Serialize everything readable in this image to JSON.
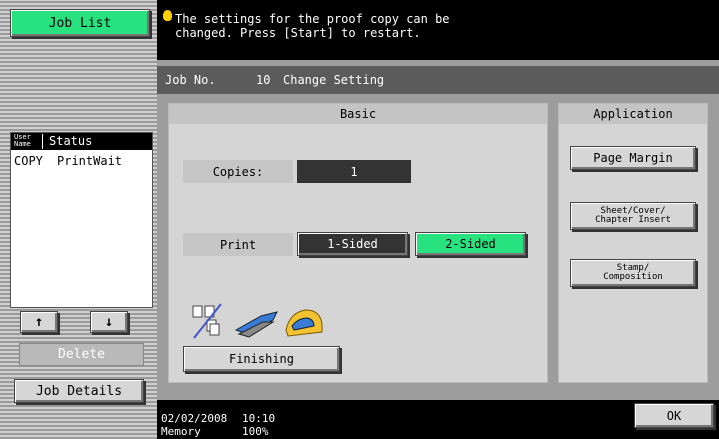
{
  "left": {
    "job_list_label": "Job List",
    "table": {
      "col_user": "User\nName",
      "col_status": "Status",
      "row": {
        "user": "COPY",
        "status": "PrintWait"
      }
    },
    "delete_label": "Delete",
    "job_details_label": "Job Details"
  },
  "top": {
    "message": "The settings for the proof copy can be\nchanged. Press [Start] to restart."
  },
  "main": {
    "job_no_label": "Job No.",
    "job_no": "10",
    "change_setting": "Change Setting",
    "basic": {
      "header": "Basic",
      "copies_label": "Copies:",
      "copies_value": "1",
      "print_label": "Print",
      "one_sided": "1-Sided",
      "two_sided": "2-Sided",
      "finishing": "Finishing"
    },
    "application": {
      "header": "Application",
      "page_margin": "Page Margin",
      "sheet_cover": "Sheet/Cover/\nChapter Insert",
      "stamp": "Stamp/\nComposition"
    }
  },
  "bottom": {
    "date": "02/02/2008",
    "time": "10:10",
    "memory_label": "Memory",
    "memory_value": "100%",
    "ok_label": "OK"
  }
}
